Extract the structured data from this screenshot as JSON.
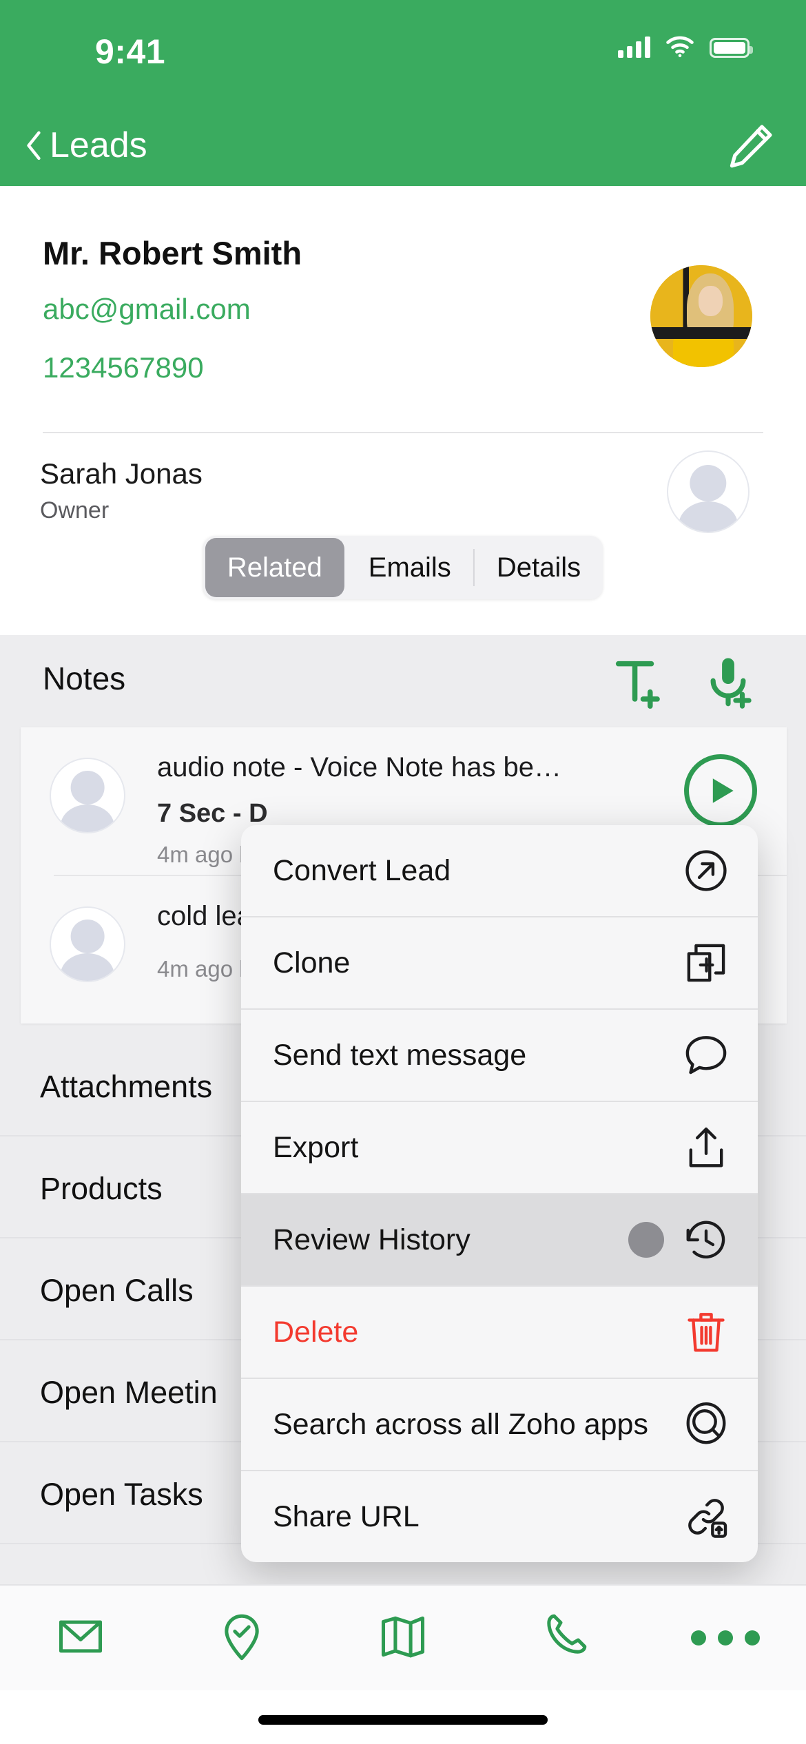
{
  "theme": {
    "brand_green": "#3AAB5F",
    "accent_green": "#2E9B52",
    "danger_red": "#F33A2F"
  },
  "status_bar": {
    "time": "9:41",
    "icons": [
      "cellular-signal-icon",
      "wifi-icon",
      "battery-icon"
    ]
  },
  "nav_bar": {
    "back_label": "Leads",
    "back_icon": "chevron-left-icon",
    "edit_icon": "pencil-edit-icon"
  },
  "lead": {
    "name": "Mr. Robert Smith",
    "email": "abc@gmail.com",
    "phone": "1234567890",
    "photo": "lead-photo-avatar"
  },
  "owner": {
    "name": "Sarah Jonas",
    "role": "Owner",
    "avatar": "owner-placeholder-avatar"
  },
  "tabs": {
    "items": [
      {
        "label": "Related",
        "selected": true
      },
      {
        "label": "Emails",
        "selected": false
      },
      {
        "label": "Details",
        "selected": false
      }
    ]
  },
  "notes": {
    "title": "Notes",
    "add_text_icon": "add-text-note-icon",
    "add_voice_icon": "add-voice-note-icon",
    "items": [
      {
        "title": "audio note - Voice Note has be…",
        "meta": "7 Sec  -  D",
        "sub": "4m ago b",
        "play_icon": "play-circle-icon"
      },
      {
        "title": "cold lea",
        "meta": "",
        "sub": "4m ago b",
        "play_icon": ""
      }
    ]
  },
  "related_lists": [
    {
      "label": "Attachments"
    },
    {
      "label": "Products"
    },
    {
      "label": "Open Calls"
    },
    {
      "label": "Open Meetin"
    },
    {
      "label": "Open Tasks"
    }
  ],
  "context_menu": {
    "items": [
      {
        "label": "Convert Lead",
        "icon": "arrow-up-right-circle-icon",
        "danger": false,
        "pressed": false
      },
      {
        "label": "Clone",
        "icon": "duplicate-plus-icon",
        "danger": false,
        "pressed": false
      },
      {
        "label": "Send text message",
        "icon": "speech-bubble-icon",
        "danger": false,
        "pressed": false
      },
      {
        "label": "Export",
        "icon": "share-upload-icon",
        "danger": false,
        "pressed": false
      },
      {
        "label": "Review History",
        "icon": "clock-rewind-icon",
        "danger": false,
        "pressed": true
      },
      {
        "label": "Delete",
        "icon": "trash-icon",
        "danger": true,
        "pressed": false
      },
      {
        "label": "Search across all Zoho apps",
        "icon": "magnifier-circle-icon",
        "danger": false,
        "pressed": false
      },
      {
        "label": "Share URL",
        "icon": "link-share-icon",
        "danger": false,
        "pressed": false
      }
    ]
  },
  "toolbar": {
    "items": [
      {
        "icon": "envelope-email-icon"
      },
      {
        "icon": "check-in-pin-icon"
      },
      {
        "icon": "map-icon"
      },
      {
        "icon": "phone-call-icon"
      },
      {
        "icon": "more-dots-icon"
      }
    ]
  }
}
